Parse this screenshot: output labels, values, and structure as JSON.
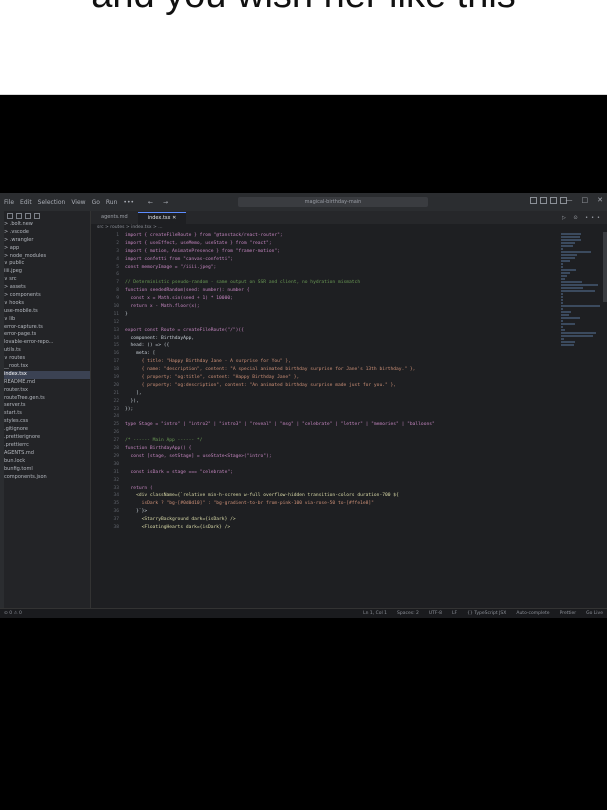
{
  "caption": {
    "text": "and you wish her like this"
  },
  "titlebar": {
    "menus": [
      "File",
      "Edit",
      "Selection",
      "View",
      "Go",
      "Run",
      "•••"
    ],
    "nav": "← →",
    "command_center": "magical-birthday-main",
    "window_controls": [
      "—",
      "□",
      "✕"
    ]
  },
  "sidebar": {
    "items": [
      {
        "label": "> .bolt.new",
        "selected": false
      },
      {
        "label": "> .vscode",
        "selected": false
      },
      {
        "label": "> .wrangler",
        "selected": false
      },
      {
        "label": "> app",
        "selected": false
      },
      {
        "label": "> node_modules",
        "selected": false
      },
      {
        "label": "∨ public",
        "selected": false
      },
      {
        "label": "   iiii.jpeg",
        "selected": false
      },
      {
        "label": "∨ src",
        "selected": false
      },
      {
        "label": "  > assets",
        "selected": false
      },
      {
        "label": "  > components",
        "selected": false
      },
      {
        "label": "  ∨ hooks",
        "selected": false
      },
      {
        "label": "     use-mobile.ts",
        "selected": false
      },
      {
        "label": "  ∨ lib",
        "selected": false
      },
      {
        "label": "     error-capture.ts",
        "selected": false
      },
      {
        "label": "     error-page.ts",
        "selected": false
      },
      {
        "label": "     lovable-error-repo...",
        "selected": false
      },
      {
        "label": "     utils.ts",
        "selected": false
      },
      {
        "label": "  ∨ routes",
        "selected": false
      },
      {
        "label": "     __root.tsx",
        "selected": false
      },
      {
        "label": "     index.tsx",
        "selected": true
      },
      {
        "label": "     README.md",
        "selected": false
      },
      {
        "label": "   router.tsx",
        "selected": false
      },
      {
        "label": "   routeTree.gen.ts",
        "selected": false
      },
      {
        "label": "   server.ts",
        "selected": false
      },
      {
        "label": "   start.ts",
        "selected": false
      },
      {
        "label": "   styles.css",
        "selected": false
      },
      {
        "label": "   .gitignore",
        "selected": false
      },
      {
        "label": "   .prettierignore",
        "selected": false
      },
      {
        "label": "   .prettierrc",
        "selected": false
      },
      {
        "label": "   AGENTS.md",
        "selected": false
      },
      {
        "label": "   bun.lock",
        "selected": false
      },
      {
        "label": "   bunfig.toml",
        "selected": false
      },
      {
        "label": "   components.json",
        "selected": false
      }
    ]
  },
  "tabs": [
    {
      "label": "agents.md",
      "active": false
    },
    {
      "label": "index.tsx  ✕",
      "active": true
    }
  ],
  "tab_actions": "▷ ⊙ •••",
  "breadcrumb": "src > routes > index.tsx > ...",
  "code": [
    {
      "n": "1",
      "t": "import { createFileRoute } from \"@tanstack/react-router\";"
    },
    {
      "n": "2",
      "t": "import { useEffect, useMemo, useState } from \"react\";"
    },
    {
      "n": "3",
      "t": "import { motion, AnimatePresence } from \"framer-motion\";"
    },
    {
      "n": "4",
      "t": "import confetti from \"canvas-confetti\";"
    },
    {
      "n": "5",
      "t": "const memoryImage = \"/iiii.jpeg\";"
    },
    {
      "n": "6",
      "t": ""
    },
    {
      "n": "7",
      "t": "// Deterministic pseudo-random - same output on SSR and client, no hydration mismatch"
    },
    {
      "n": "8",
      "t": "function seededRandom(seed: number): number {"
    },
    {
      "n": "9",
      "t": "  const x = Math.sin(seed + 1) * 10000;"
    },
    {
      "n": "10",
      "t": "  return x - Math.floor(x);"
    },
    {
      "n": "11",
      "t": "}"
    },
    {
      "n": "12",
      "t": ""
    },
    {
      "n": "13",
      "t": "export const Route = createFileRoute(\"/\")({"
    },
    {
      "n": "14",
      "t": "  component: BirthdayApp,"
    },
    {
      "n": "15",
      "t": "  head: () => ({"
    },
    {
      "n": "16",
      "t": "    meta: ["
    },
    {
      "n": "17",
      "t": "      { title: \"Happy Birthday Jane - A surprise for You\" },"
    },
    {
      "n": "18",
      "t": "      { name: \"description\", content: \"A special animated birthday surprise for Jane's 13th birthday.\" },"
    },
    {
      "n": "19",
      "t": "      { property: \"og:title\", content: \"Happy Birthday Jane\" },"
    },
    {
      "n": "20",
      "t": "      { property: \"og:description\", content: \"An animated birthday surprise made just for you.\" },"
    },
    {
      "n": "21",
      "t": "    ],"
    },
    {
      "n": "22",
      "t": "  }),"
    },
    {
      "n": "23",
      "t": "});"
    },
    {
      "n": "24",
      "t": ""
    },
    {
      "n": "25",
      "t": "type Stage = \"intro\" | \"intro2\" | \"intro3\" | \"reveal\" | \"msg\" | \"celebrate\" | \"letter\" | \"memories\" | \"balloons\""
    },
    {
      "n": "26",
      "t": ""
    },
    {
      "n": "27",
      "t": "/* ------ Main App ------ */"
    },
    {
      "n": "28",
      "t": "function BirthdayApp() {"
    },
    {
      "n": "29",
      "t": "  const [stage, setStage] = useState<Stage>(\"intro\");"
    },
    {
      "n": "30",
      "t": ""
    },
    {
      "n": "31",
      "t": "  const isDark = stage === \"celebrate\";"
    },
    {
      "n": "32",
      "t": ""
    },
    {
      "n": "33",
      "t": "  return ("
    },
    {
      "n": "34",
      "t": "    <div className={`relative min-h-screen w-full overflow-hidden transition-colors duration-700 ${"
    },
    {
      "n": "35",
      "t": "      isDark ? \"bg-[#0d0d10]\" : \"bg-gradient-to-br from-pink-100 via-rose-50 to-[#ffe1e8]\""
    },
    {
      "n": "36",
      "t": "    }`}>"
    },
    {
      "n": "37",
      "t": "      <StarryBackground dark={isDark} />"
    },
    {
      "n": "38",
      "t": "      <FloatingHearts dark={isDark} />"
    }
  ],
  "statusbar": {
    "left": "⊙ 0 ⚠ 0",
    "right": [
      "Ln 1, Col 1",
      "Spaces: 2",
      "UTF-8",
      "LF",
      "{} TypeScript JSX",
      "Auto-complete",
      "Prettier",
      "Go Live"
    ]
  },
  "colors": {
    "editor_bg": "#1e1f22",
    "sidebar_bg": "#232427",
    "selection": "#3b4253",
    "accent": "#5c8cff"
  }
}
